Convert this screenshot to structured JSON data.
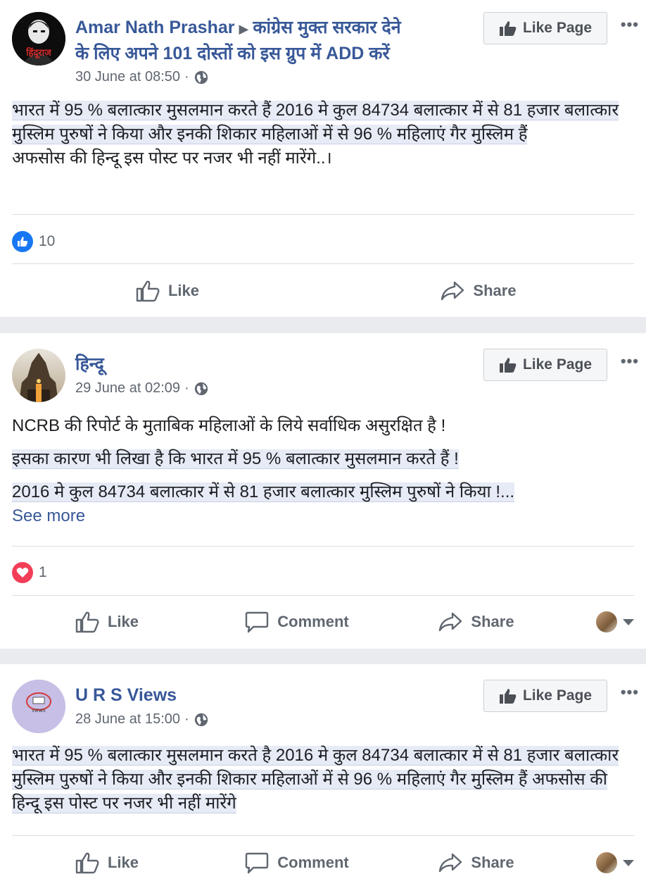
{
  "posts": [
    {
      "author": "Amar Nath Prashar",
      "group_line1": "कांग्रेस मुक्त सरकार देने",
      "group_line2": "के लिए अपने 101 दोस्तों को इस ग्रुप में ADD करें",
      "timestamp": "30 June at 08:50",
      "avatar_text": "हिंदूराज",
      "like_page_label": "Like Page",
      "more_label": "•••",
      "paragraphs": [
        "भारत में 95 % बलात्कार मुसलमान करते हैं 2016 मे कुल 84734 बलात्कार में से 81 हजार बलात्कार मुस्लिम पुरुषों ने किया और इनकी शिकार महिलाओं में से 96 % महिलाएं गैर मुस्लिम हैं",
        "अफसोस की हिन्दू इस पोस्ट पर नजर भी नहीं मारेंगे..।"
      ],
      "reaction_count": "10",
      "reaction_type": "like",
      "actions": {
        "like": "Like",
        "share": "Share"
      }
    },
    {
      "author": "हिन्दू",
      "timestamp": "29 June at 02:09",
      "like_page_label": "Like Page",
      "more_label": "•••",
      "paragraphs": [
        "NCRB की रिपोर्ट के मुताबिक महिलाओं के लिये सर्वाधिक असुरक्षित है !",
        "इसका कारण भी लिखा है कि भारत में 95 % बलात्कार मुसलमान करते हैं !",
        "2016 मे कुल 84734 बलात्कार में से 81 हजार बलात्कार मुस्लिम पुरुषों ने किया !..."
      ],
      "see_more": "See more",
      "reaction_count": "1",
      "reaction_type": "love",
      "actions": {
        "like": "Like",
        "comment": "Comment",
        "share": "Share"
      }
    },
    {
      "author": "U R S Views",
      "timestamp": "28 June at 15:00",
      "like_page_label": "Like Page",
      "more_label": "•••",
      "avatar_text": "VIEWS",
      "paragraphs": [
        "भारत में 95 % बलात्कार मुसलमान करते है 2016 मे कुल 84734 बलात्कार में से 81 हजार बलात्कार मुस्लिम पुरुषों ने किया और इनकी शिकार महिलाओं में से 96 % महिलाएं गैर मुस्लिम हैं अफसोस की हिन्दू इस पोस्ट पर नजर भी नहीं मारेंगे"
      ],
      "actions": {
        "like": "Like",
        "comment": "Comment",
        "share": "Share"
      }
    }
  ],
  "colors": {
    "link_blue": "#385898",
    "like_blue": "#1877f2",
    "love_red": "#f33e58",
    "separator": "#e9ebee",
    "highlight": "#e7ebf6"
  }
}
